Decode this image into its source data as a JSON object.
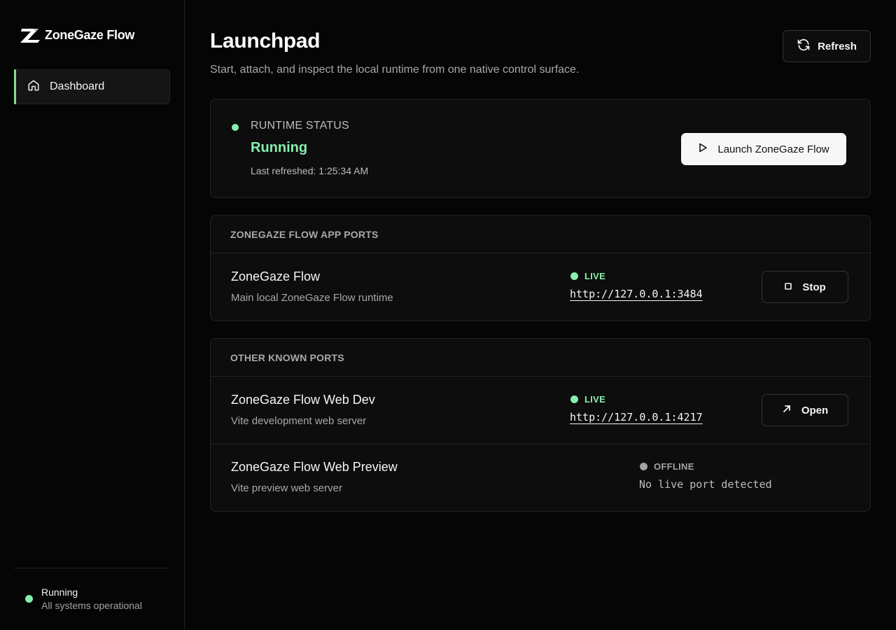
{
  "brand": {
    "name": "ZoneGaze Flow"
  },
  "sidebar": {
    "items": [
      {
        "label": "Dashboard",
        "icon": "home-icon",
        "active": true
      }
    ],
    "footer": {
      "status": "Running",
      "detail": "All systems operational"
    }
  },
  "header": {
    "title": "Launchpad",
    "subtitle": "Start, attach, and inspect the local runtime from one native control surface.",
    "refresh_label": "Refresh"
  },
  "runtime": {
    "label": "RUNTIME STATUS",
    "value": "Running",
    "last_refreshed": "Last refreshed: 1:25:34 AM",
    "launch_label": "Launch ZoneGaze Flow"
  },
  "app_ports": {
    "heading": "ZONEGAZE FLOW APP PORTS",
    "rows": [
      {
        "name": "ZoneGaze Flow",
        "description": "Main local ZoneGaze Flow runtime",
        "status": "LIVE",
        "url": "http://127.0.0.1:3484",
        "action": "Stop"
      }
    ]
  },
  "other_ports": {
    "heading": "OTHER KNOWN PORTS",
    "rows": [
      {
        "name": "ZoneGaze Flow Web Dev",
        "description": "Vite development web server",
        "status": "LIVE",
        "url": "http://127.0.0.1:4217",
        "action": "Open"
      },
      {
        "name": "ZoneGaze Flow Web Preview",
        "description": "Vite preview web server",
        "status": "OFFLINE",
        "url": "No live port detected"
      }
    ]
  },
  "colors": {
    "accent_live": "#86efac",
    "offline": "#a3a3a3",
    "background": "#050505"
  }
}
